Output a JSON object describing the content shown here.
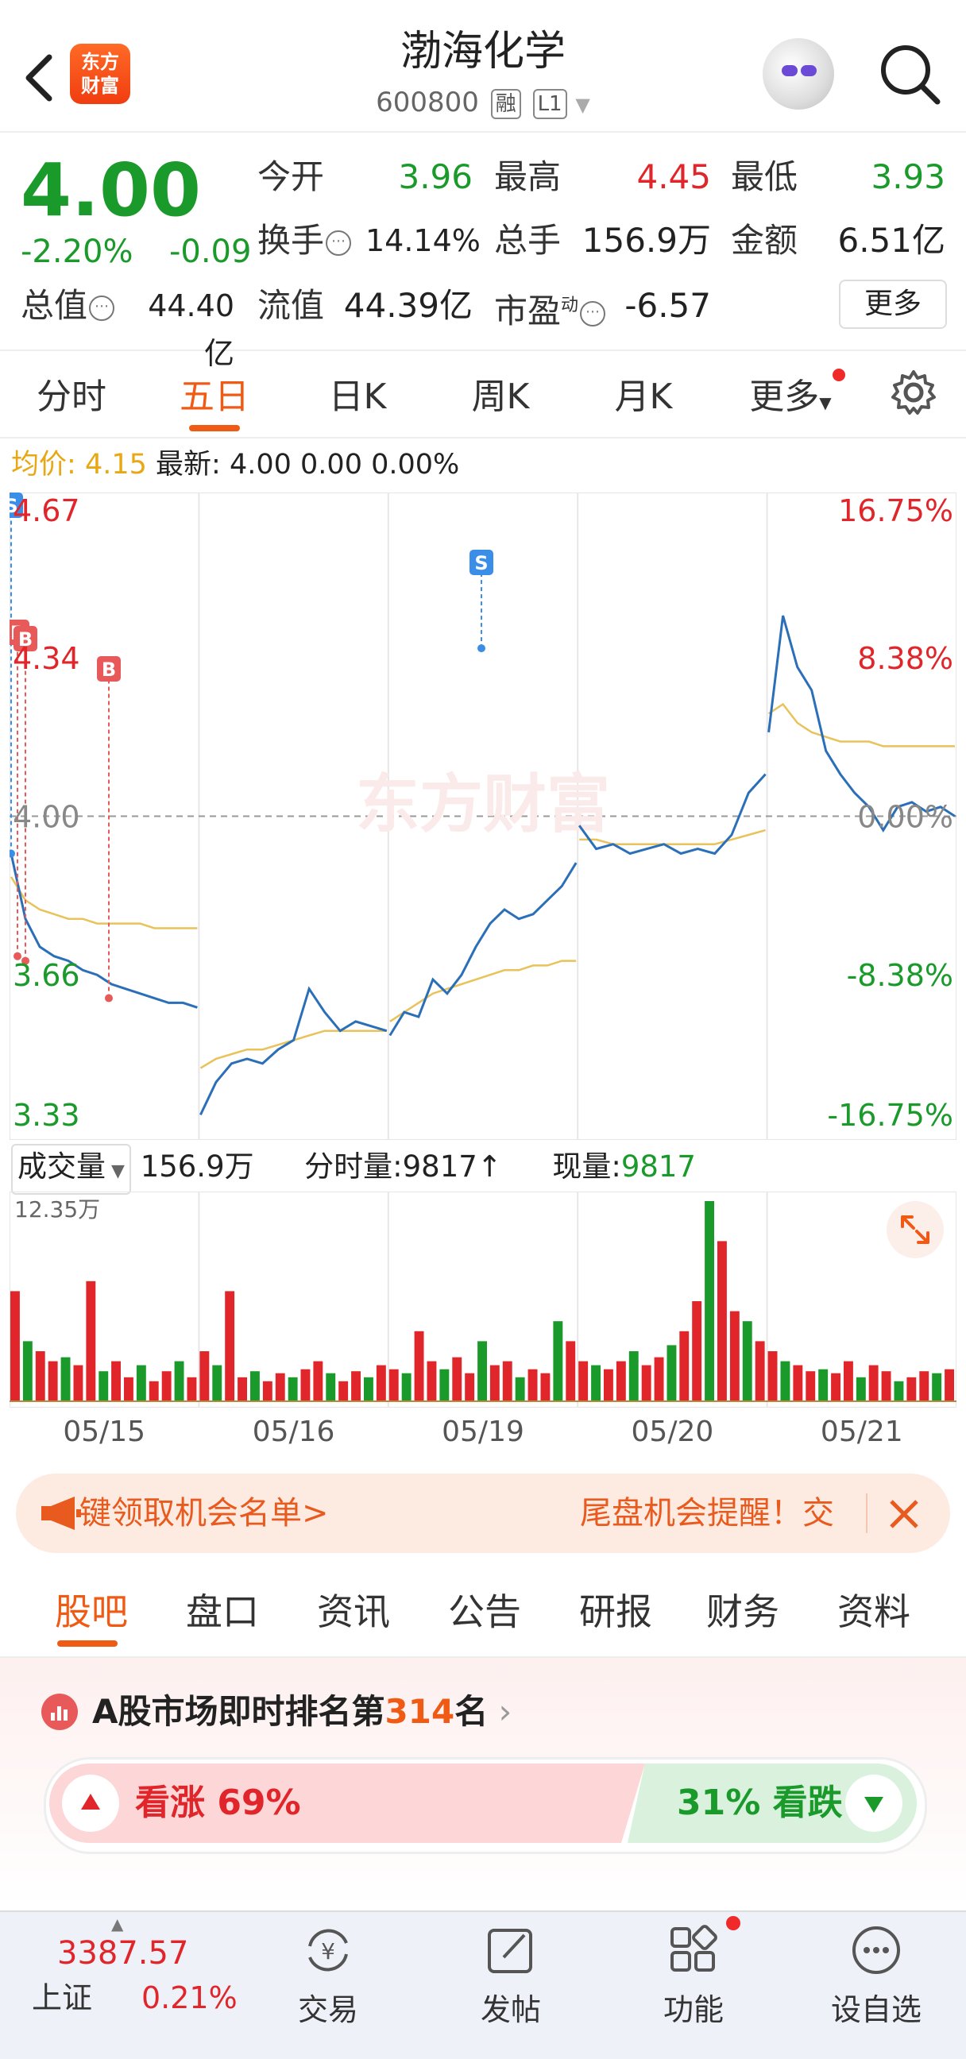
{
  "header": {
    "back_icon": "chevron-left-icon",
    "logo_line1": "东方",
    "logo_line2": "财富",
    "title": "渤海化学",
    "code": "600800",
    "tag_margin": "融",
    "tag_level": "L1",
    "search_icon": "search-icon",
    "robot_icon": "robot-avatar-icon"
  },
  "quote": {
    "price": "4.00",
    "change_pct": "-2.20%",
    "change_abs": "-0.09",
    "open_label": "今开",
    "open_value": "3.96",
    "high_label": "最高",
    "high_value": "4.45",
    "low_label": "最低",
    "low_value": "3.93",
    "turnover_label": "换手",
    "turnover_value": "14.14%",
    "volume_label": "总手",
    "volume_value": "156.9万",
    "amount_label": "金额",
    "amount_value": "6.51亿",
    "mktcap_label": "总值",
    "mktcap_value": "44.40亿",
    "float_label": "流值",
    "float_value": "44.39亿",
    "pe_label": "市盈",
    "pe_sup": "动",
    "pe_value": "-6.57",
    "more_label": "更多"
  },
  "tabs": [
    "分时",
    "五日",
    "日K",
    "周K",
    "月K",
    "更多"
  ],
  "avg": {
    "avg_label": "均价:",
    "avg_value": "4.15",
    "latest_label": "最新:",
    "latest_value": "4.00",
    "latest_change": "0.00",
    "latest_pct": "0.00%"
  },
  "chart_data": {
    "type": "line",
    "title": "",
    "x": [
      "05/15",
      "05/16",
      "05/19",
      "05/20",
      "05/21"
    ],
    "y_ticks_left": [
      "4.67",
      "4.34",
      "4.00",
      "3.66",
      "3.33"
    ],
    "y_ticks_right": [
      "16.75%",
      "8.38%",
      "0.00%",
      "-8.38%",
      "-16.75%"
    ],
    "ylim": [
      3.33,
      4.67
    ],
    "prev_close": 4.0,
    "watermark": "东方财富",
    "series": [
      {
        "values": [
          3.92,
          3.78,
          3.72,
          3.7,
          3.69,
          3.67,
          3.66,
          3.64,
          3.63,
          3.62,
          3.61,
          3.6,
          3.6,
          3.59,
          3.36,
          3.43,
          3.47,
          3.48,
          3.47,
          3.5,
          3.52,
          3.63,
          3.58,
          3.54,
          3.56,
          3.55,
          3.54,
          3.53,
          3.58,
          3.57,
          3.65,
          3.62,
          3.66,
          3.72,
          3.77,
          3.8,
          3.78,
          3.79,
          3.82,
          3.85,
          3.9,
          3.98,
          3.93,
          3.94,
          3.92,
          3.93,
          3.94,
          3.92,
          3.93,
          3.92,
          3.96,
          4.05,
          4.09,
          4.18,
          4.43,
          4.32,
          4.27,
          4.14,
          4.09,
          4.05,
          4.02,
          3.97,
          4.02,
          4.03,
          4.01,
          4.02,
          4.0
        ]
      },
      {
        "values": [
          3.87,
          3.82,
          3.8,
          3.79,
          3.78,
          3.78,
          3.77,
          3.77,
          3.77,
          3.77,
          3.76,
          3.76,
          3.76,
          3.76,
          3.46,
          3.48,
          3.49,
          3.5,
          3.5,
          3.51,
          3.52,
          3.53,
          3.54,
          3.54,
          3.54,
          3.54,
          3.54,
          3.56,
          3.58,
          3.6,
          3.62,
          3.63,
          3.64,
          3.65,
          3.66,
          3.67,
          3.67,
          3.68,
          3.68,
          3.69,
          3.69,
          3.95,
          3.95,
          3.94,
          3.94,
          3.94,
          3.94,
          3.94,
          3.94,
          3.94,
          3.95,
          3.96,
          3.97,
          4.22,
          4.24,
          4.2,
          4.18,
          4.17,
          4.16,
          4.16,
          4.16,
          4.15,
          4.15,
          4.15,
          4.15,
          4.15,
          4.15
        ]
      }
    ],
    "volume_max_label": "12.35万",
    "volume": [
      0.55,
      0.3,
      0.25,
      0.2,
      0.22,
      0.18,
      0.6,
      0.15,
      0.2,
      0.12,
      0.18,
      0.1,
      0.15,
      0.2,
      0.12,
      0.25,
      0.18,
      0.55,
      0.12,
      0.15,
      0.1,
      0.14,
      0.12,
      0.16,
      0.2,
      0.14,
      0.1,
      0.15,
      0.12,
      0.18,
      0.16,
      0.14,
      0.35,
      0.2,
      0.16,
      0.22,
      0.14,
      0.3,
      0.18,
      0.2,
      0.12,
      0.16,
      0.14,
      0.4,
      0.3,
      0.2,
      0.18,
      0.16,
      0.2,
      0.25,
      0.18,
      0.22,
      0.28,
      0.35,
      0.5,
      1.0,
      0.8,
      0.45,
      0.4,
      0.3,
      0.25,
      0.2,
      0.18,
      0.15,
      0.16,
      0.14,
      0.2,
      0.12,
      0.18,
      0.15,
      0.1,
      0.12,
      0.15,
      0.14,
      0.16
    ],
    "markers": [
      {
        "label": "S",
        "color": "#3a8ee8"
      },
      {
        "label": "B",
        "color": "#e85a5a"
      },
      {
        "label": "B",
        "color": "#e85a5a"
      },
      {
        "label": "B",
        "color": "#e85a5a"
      },
      {
        "label": "S",
        "color": "#3a8ee8"
      }
    ]
  },
  "volume_head": {
    "select_label": "成交量",
    "total": "156.9万",
    "tick_label": "分时量:9817",
    "arrow": "↑",
    "now_label": "现量:",
    "now_value": "9817"
  },
  "banner": {
    "icon": "megaphone-icon",
    "left_text": "键领取机会名单>",
    "right_text": "尾盘机会提醒！交",
    "close_icon": "close-icon"
  },
  "sections": [
    "股吧",
    "盘口",
    "资讯",
    "公告",
    "研报",
    "财务",
    "资料"
  ],
  "ranking": {
    "prefix": "A股市场即时排名第",
    "rank": "314",
    "suffix": "名",
    "bull_label": "看涨 69%",
    "bear_label": "31% 看跌",
    "bull_pct": 69,
    "bear_pct": 31
  },
  "bottom": {
    "index_value": "3387.57",
    "index_name": "上证",
    "index_pct": "0.21%",
    "items": [
      {
        "label": "交易",
        "icon": "yuan-trade-icon"
      },
      {
        "label": "发帖",
        "icon": "edit-post-icon"
      },
      {
        "label": "功能",
        "icon": "grid-apps-icon"
      },
      {
        "label": "设自选",
        "icon": "more-dots-icon"
      }
    ]
  },
  "colors": {
    "up": "#e0262a",
    "down": "#1a9a2a",
    "accent": "#ef5b15",
    "price_line": "#2a6fb8",
    "avg_line": "#e8c25a"
  }
}
